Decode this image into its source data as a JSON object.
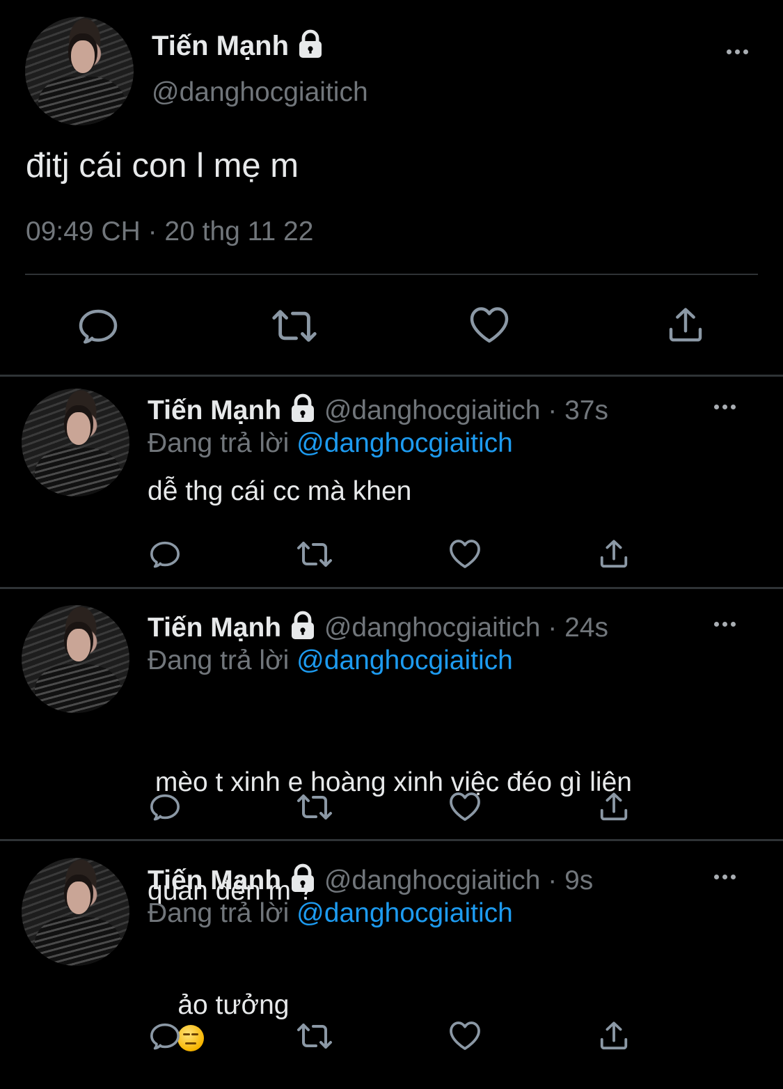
{
  "main_tweet": {
    "display_name": "Tiến Mạnh",
    "handle": "@danghocgiaitich",
    "text": "đitj cái con l mẹ m",
    "timestamp": "09:49 CH · 20 thg 11 22",
    "icons": [
      "reply-icon",
      "retweet-icon",
      "like-icon",
      "share-icon"
    ]
  },
  "replies": [
    {
      "display_name": "Tiến Mạnh",
      "handle": "@danghocgiaitich",
      "time": "· 37s",
      "replying_label": "Đang trả lời",
      "replying_to": "@danghocgiaitich",
      "text_lines": [
        "dễ thg cái cc mà khen"
      ]
    },
    {
      "display_name": "Tiến Mạnh",
      "handle": "@danghocgiaitich",
      "time": "· 24s",
      "replying_label": "Đang trả lời",
      "replying_to": "@danghocgiaitich",
      "text_lines": [
        " mèo t xinh e hoàng xinh việc đéo gì liên",
        "quan đến m ?"
      ]
    },
    {
      "display_name": "Tiến Mạnh",
      "handle": "@danghocgiaitich",
      "time": "· 9s",
      "replying_label": "Đang trả lời",
      "replying_to": "@danghocgiaitich",
      "text_lines": [
        "ảo tưởng"
      ],
      "emoji": "expressionless-face-emoji"
    }
  ],
  "colors": {
    "background": "#000000",
    "text": "#e7e9ea",
    "secondary": "#71767b",
    "link": "#1d9bf0",
    "divider": "#2f3336"
  }
}
